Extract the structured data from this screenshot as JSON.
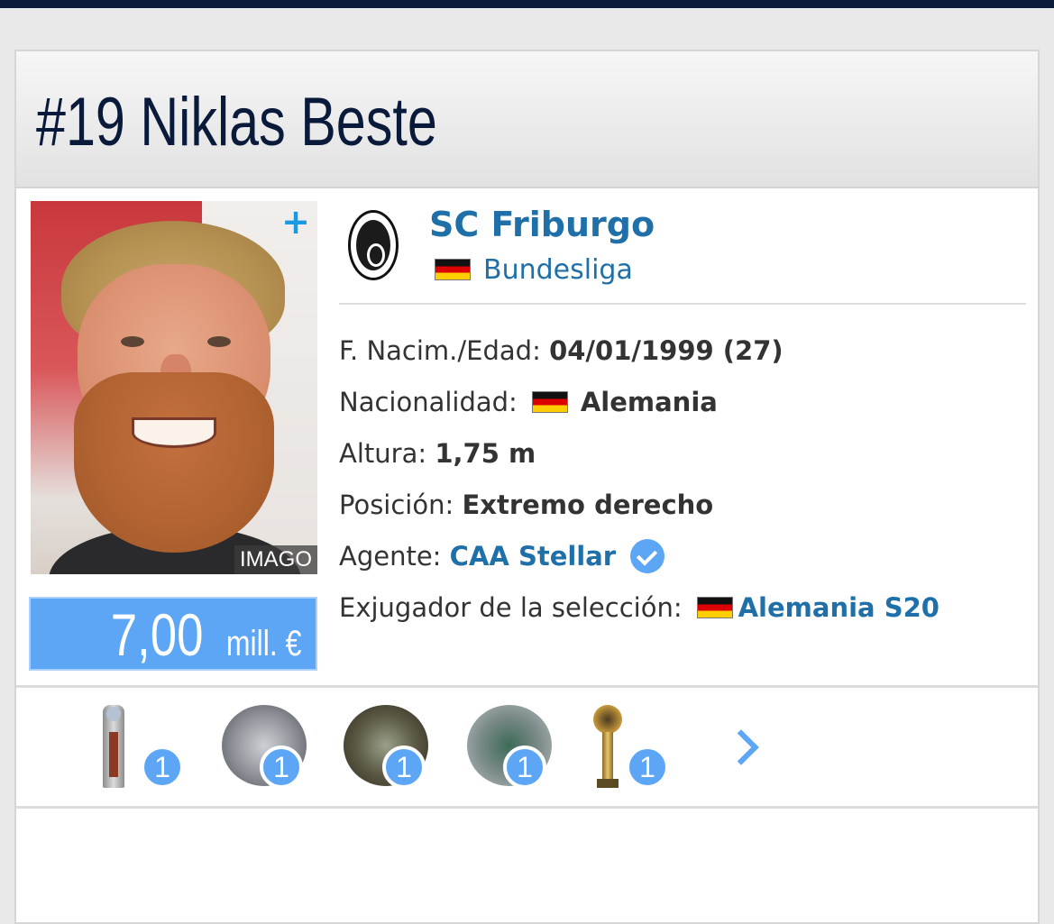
{
  "player": {
    "title": "#19 Niklas Beste",
    "photo_credit": "IMAGO",
    "market_value": "7,00",
    "market_value_unit": "mill. €"
  },
  "club": {
    "name": "SC Friburgo",
    "league": "Bundesliga"
  },
  "info": {
    "birth_label": "F. Nacim./Edad:",
    "birth_value": "04/01/1999 (27)",
    "nationality_label": "Nacionalidad:",
    "nationality_value": "Alemania",
    "height_label": "Altura:",
    "height_value": "1,75 m",
    "position_label": "Posición:",
    "position_value": "Extremo derecho",
    "agent_label": "Agente:",
    "agent_value": "CAA Stellar",
    "national_team_label": "Exjugador de la selección:",
    "national_team_value": "Alemania S20"
  },
  "trophies": [
    {
      "icon": "tall-cup-trophy-icon",
      "count": "1"
    },
    {
      "icon": "silver-plate-trophy-icon",
      "count": "1"
    },
    {
      "icon": "bronze-plate-trophy-icon",
      "count": "1"
    },
    {
      "icon": "green-plate-trophy-icon",
      "count": "1"
    },
    {
      "icon": "star-trophy-icon",
      "count": "1"
    }
  ],
  "colors": {
    "header_navy": "#0b1c3b",
    "link_blue": "#1f6fa8",
    "accent_blue": "#5ca6f5"
  }
}
